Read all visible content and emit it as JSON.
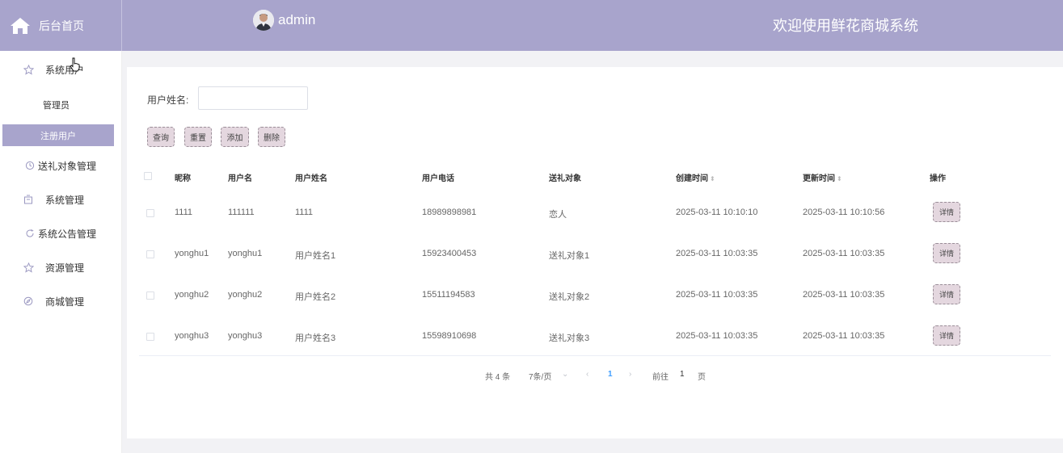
{
  "header": {
    "brand_title": "后台首页",
    "user_name": "admin",
    "welcome": "欢迎使用鲜花商城系统",
    "color": "#a8a4cc"
  },
  "sidebar": {
    "items": [
      {
        "label": "系统用户",
        "icon": "star-icon"
      },
      {
        "label": "送礼对象管理",
        "icon": "clock-icon"
      },
      {
        "label": "系统管理",
        "icon": "box-icon"
      },
      {
        "label": "系统公告管理",
        "icon": "refresh-icon"
      },
      {
        "label": "资源管理",
        "icon": "star-icon"
      },
      {
        "label": "商城管理",
        "icon": "compass-icon"
      }
    ],
    "sub_items": [
      "管理员",
      "注册用户"
    ],
    "active_sub": "注册用户"
  },
  "search": {
    "label": "用户姓名:",
    "value": "",
    "placeholder": ""
  },
  "toolbar": {
    "query": "查询",
    "reset": "重置",
    "add": "添加",
    "delete": "删除"
  },
  "table": {
    "headers": [
      "昵称",
      "用户名",
      "用户姓名",
      "用户电话",
      "送礼对象",
      "创建时间",
      "更新时间",
      "操作"
    ],
    "rows": [
      {
        "nickname": "1111",
        "username": "111111",
        "realname": "1111",
        "phone": "18989898981",
        "target": "恋人",
        "created": "2025-03-11 10:10:10",
        "updated": "2025-03-11 10:10:56",
        "action": "详情"
      },
      {
        "nickname": "yonghu1",
        "username": "yonghu1",
        "realname": "用户姓名1",
        "phone": "15923400453",
        "target": "送礼对象1",
        "created": "2025-03-11 10:03:35",
        "updated": "2025-03-11 10:03:35",
        "action": "详情"
      },
      {
        "nickname": "yonghu2",
        "username": "yonghu2",
        "realname": "用户姓名2",
        "phone": "15511194583",
        "target": "送礼对象2",
        "created": "2025-03-11 10:03:35",
        "updated": "2025-03-11 10:03:35",
        "action": "详情"
      },
      {
        "nickname": "yonghu3",
        "username": "yonghu3",
        "realname": "用户姓名3",
        "phone": "15598910698",
        "target": "送礼对象3",
        "created": "2025-03-11 10:03:35",
        "updated": "2025-03-11 10:03:35",
        "action": "详情"
      }
    ]
  },
  "pagination": {
    "total": "共 4 条",
    "page_size": "7条/页",
    "current_page": "1",
    "goto_prefix": "前往",
    "goto_value": "1",
    "goto_suffix": "页"
  }
}
